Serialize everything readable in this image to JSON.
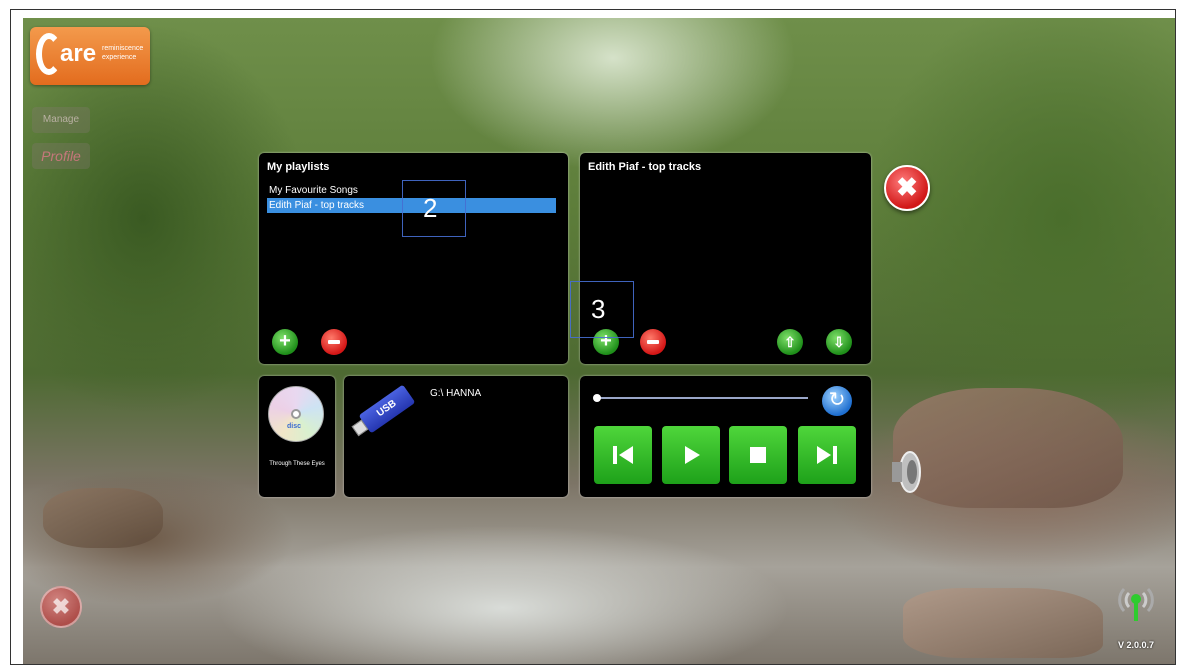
{
  "logo": {
    "letters": "are",
    "tagline_1": "reminiscence",
    "tagline_2": "experience"
  },
  "side": {
    "btn1": "Manage",
    "btn2": "Profile"
  },
  "playlists": {
    "title": "My playlists",
    "items": [
      "My Favourite Songs",
      "Edith Piaf - top tracks"
    ],
    "selected_index": 1
  },
  "tracks": {
    "title": "Edith Piaf - top tracks"
  },
  "cd": {
    "disc_text": "disc",
    "label": "Through These Eyes"
  },
  "usb": {
    "badge": "USB",
    "drive": "G:\\ HANNA"
  },
  "player": {
    "progress": 0
  },
  "annotations": {
    "a2": "2",
    "a3": "3"
  },
  "footer": {
    "version": "V 2.0.0.7"
  },
  "colors": {
    "accent_orange": "#e36c1e",
    "selection_blue": "#3a8fe0",
    "button_green": "#1ea11a",
    "button_red": "#d41616"
  }
}
